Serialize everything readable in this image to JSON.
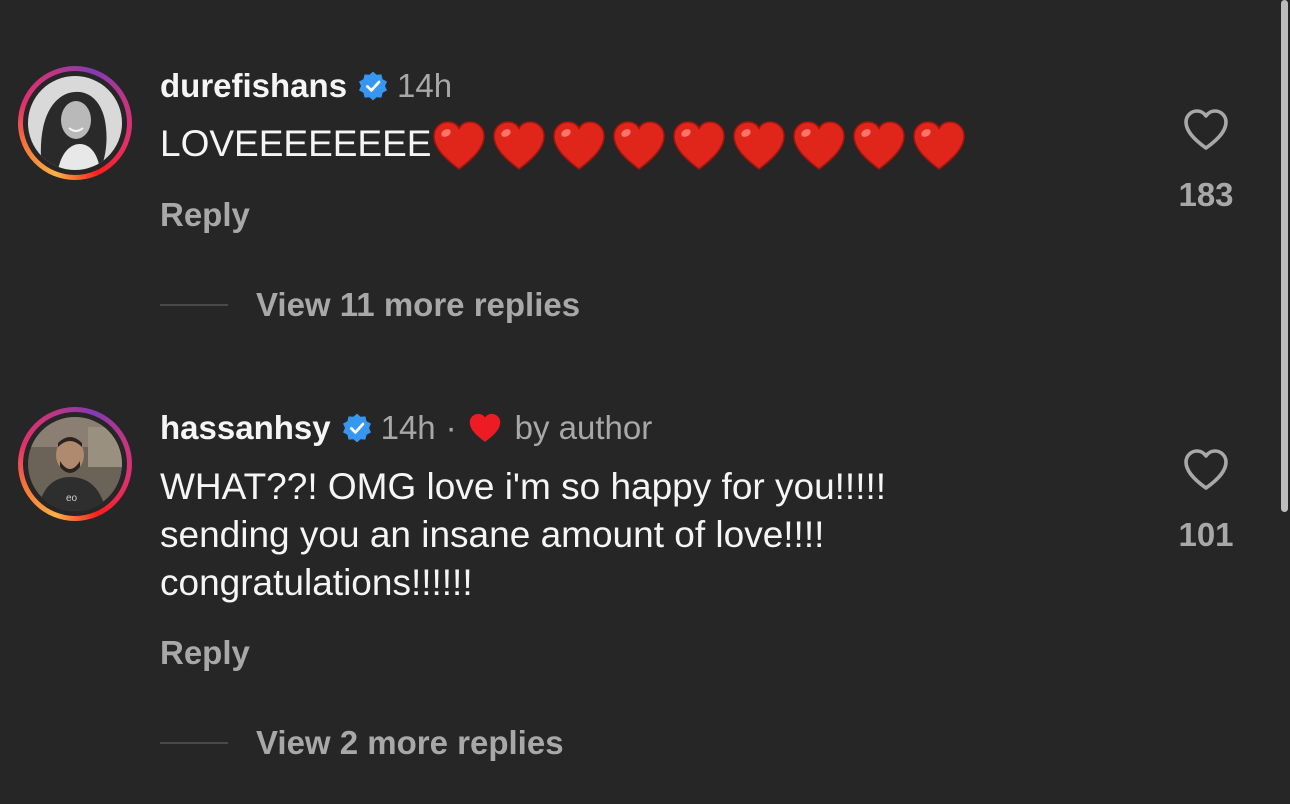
{
  "comments": [
    {
      "username": "durefishans",
      "verified": true,
      "time": "14h",
      "text": "LOVEEEEEEEE",
      "heart_emoji_count": 9,
      "reply_label": "Reply",
      "likes": "183",
      "view_replies": "View 11 more replies"
    },
    {
      "username": "hassanhsy",
      "verified": true,
      "time": "14h",
      "separator": "·",
      "liked_by_author": "by author",
      "text_lines": [
        "WHAT??! OMG love i'm so happy for you!!!!!",
        "sending you an insane amount of love!!!!",
        "congratulations!!!!!!"
      ],
      "reply_label": "Reply",
      "likes": "101",
      "view_replies": "View 2 more replies"
    }
  ],
  "icons": {
    "verified": "verified-badge-icon",
    "like": "heart-outline-icon",
    "author_like": "red-heart-icon",
    "emoji": "red-heart-emoji"
  },
  "colors": {
    "background": "#262626",
    "primary_text": "#f5f5f5",
    "secondary_text": "#a8a8a8",
    "verified_blue": "#3797f0",
    "heart_red": "#e0261b"
  }
}
